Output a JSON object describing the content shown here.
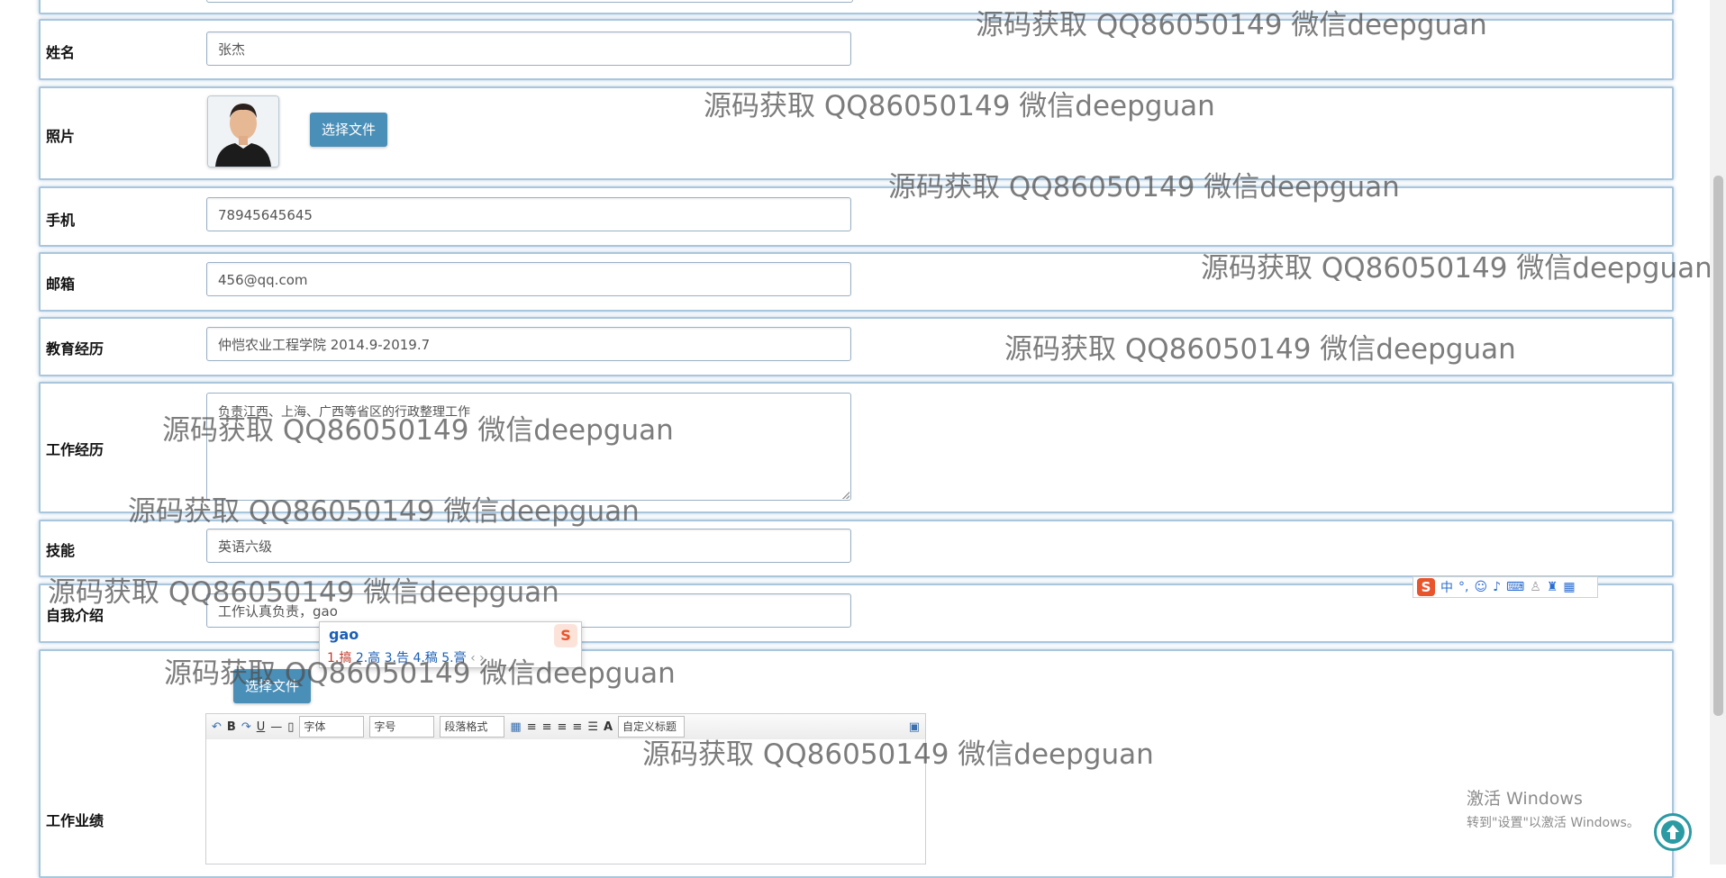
{
  "form": {
    "name_label": "姓名",
    "name_value": "张杰",
    "photo_label": "照片",
    "photo_button": "选择文件",
    "phone_label": "手机",
    "phone_value": "78945645645",
    "email_label": "邮箱",
    "email_value": "456@qq.com",
    "education_label": "教育经历",
    "education_value": "仲恺农业工程学院 2014.9-2019.7",
    "work_label": "工作经历",
    "work_value": "负责江西、上海、广西等省区的行政整理工作",
    "skills_label": "技能",
    "skills_value": "英语六级",
    "intro_label": "自我介绍",
    "intro_value": "工作认真负责，gao",
    "achievement_label": "工作业绩",
    "achievement_button": "选择文件"
  },
  "editor_toolbar": {
    "bold": "B",
    "underline": "U",
    "font_family": "字体",
    "font_size": "字号",
    "paragraph": "段落格式",
    "font_color": "A",
    "custom_title": "自定义标题"
  },
  "ime": {
    "pinyin": "gao",
    "candidates": [
      "1.搞",
      "2.高",
      "3.告",
      "4.稿",
      "5.膏"
    ],
    "bar_lang": "中",
    "bar_punct": "°,"
  },
  "watermark_text": "源码获取 QQ86050149 微信deepguan",
  "windows_activation": {
    "line1": "激活 Windows",
    "line2": "转到\"设置\"以激活 Windows。"
  },
  "colors": {
    "button": "#4a8fb8",
    "row_border": "#a9c6dc",
    "ime_accent": "#e8542c"
  }
}
